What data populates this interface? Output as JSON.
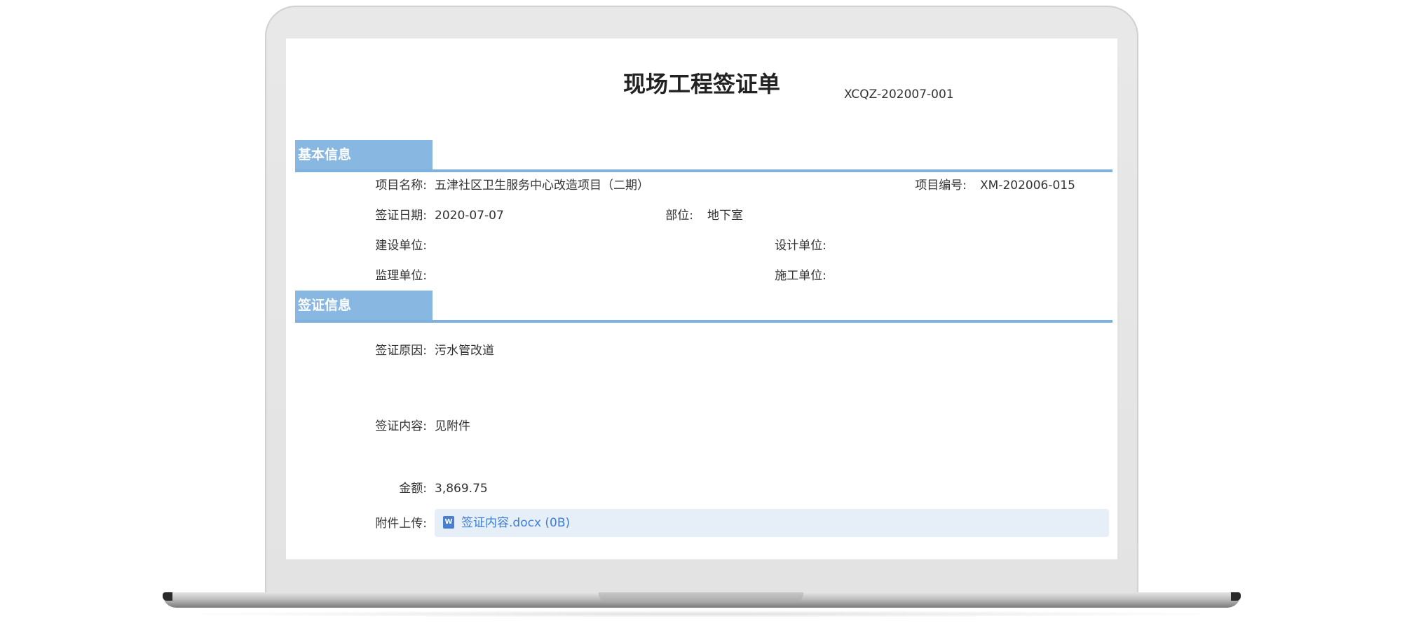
{
  "document": {
    "title": "现场工程签证单",
    "code": "XCQZ-202007-001"
  },
  "sections": {
    "basic": "基本信息",
    "visa": "签证信息"
  },
  "basic_info": {
    "project_name_label": "项目名称:",
    "project_name": "五津社区卫生服务中心改造项目（二期）",
    "project_no_label": "项目编号:",
    "project_no": "XM-202006-015",
    "visa_date_label": "签证日期:",
    "visa_date": "2020-07-07",
    "location_label": "部位:",
    "location": "地下室",
    "construction_unit_label": "建设单位:",
    "construction_unit": "",
    "design_unit_label": "设计单位:",
    "design_unit": "",
    "supervision_unit_label": "监理单位:",
    "supervision_unit": "",
    "contractor_label": "施工单位:",
    "contractor": ""
  },
  "visa_info": {
    "reason_label": "签证原因:",
    "reason": "污水管改道",
    "content_label": "签证内容:",
    "content": "见附件",
    "amount_label": "金额:",
    "amount": "3,869.75",
    "attachment_label": "附件上传:",
    "attachment_name": "签证内容.docx (0B)",
    "attachment_icon": "word-doc-icon",
    "attachment_icon_letter": "W"
  },
  "colors": {
    "section_tab": "#88b7e1",
    "section_line": "#7fb1de",
    "attachment_bg": "#e6eef8",
    "link": "#3e7fd4"
  }
}
